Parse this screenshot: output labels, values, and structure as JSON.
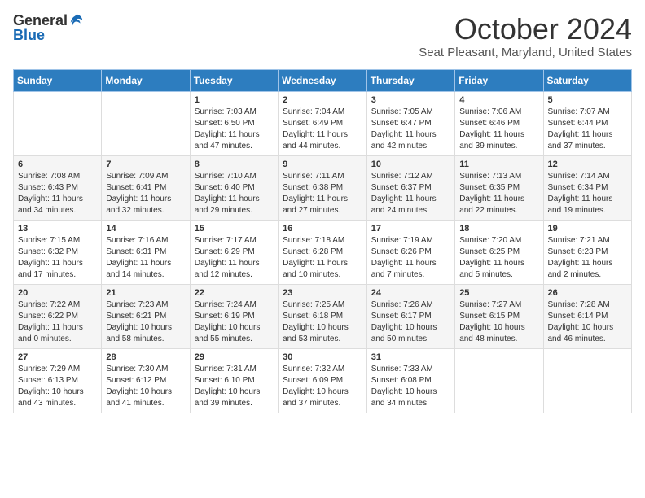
{
  "header": {
    "logo_general": "General",
    "logo_blue": "Blue",
    "month_title": "October 2024",
    "location": "Seat Pleasant, Maryland, United States"
  },
  "weekdays": [
    "Sunday",
    "Monday",
    "Tuesday",
    "Wednesday",
    "Thursday",
    "Friday",
    "Saturday"
  ],
  "weeks": [
    [
      {
        "day": "",
        "sunrise": "",
        "sunset": "",
        "daylight": ""
      },
      {
        "day": "",
        "sunrise": "",
        "sunset": "",
        "daylight": ""
      },
      {
        "day": "1",
        "sunrise": "Sunrise: 7:03 AM",
        "sunset": "Sunset: 6:50 PM",
        "daylight": "Daylight: 11 hours and 47 minutes."
      },
      {
        "day": "2",
        "sunrise": "Sunrise: 7:04 AM",
        "sunset": "Sunset: 6:49 PM",
        "daylight": "Daylight: 11 hours and 44 minutes."
      },
      {
        "day": "3",
        "sunrise": "Sunrise: 7:05 AM",
        "sunset": "Sunset: 6:47 PM",
        "daylight": "Daylight: 11 hours and 42 minutes."
      },
      {
        "day": "4",
        "sunrise": "Sunrise: 7:06 AM",
        "sunset": "Sunset: 6:46 PM",
        "daylight": "Daylight: 11 hours and 39 minutes."
      },
      {
        "day": "5",
        "sunrise": "Sunrise: 7:07 AM",
        "sunset": "Sunset: 6:44 PM",
        "daylight": "Daylight: 11 hours and 37 minutes."
      }
    ],
    [
      {
        "day": "6",
        "sunrise": "Sunrise: 7:08 AM",
        "sunset": "Sunset: 6:43 PM",
        "daylight": "Daylight: 11 hours and 34 minutes."
      },
      {
        "day": "7",
        "sunrise": "Sunrise: 7:09 AM",
        "sunset": "Sunset: 6:41 PM",
        "daylight": "Daylight: 11 hours and 32 minutes."
      },
      {
        "day": "8",
        "sunrise": "Sunrise: 7:10 AM",
        "sunset": "Sunset: 6:40 PM",
        "daylight": "Daylight: 11 hours and 29 minutes."
      },
      {
        "day": "9",
        "sunrise": "Sunrise: 7:11 AM",
        "sunset": "Sunset: 6:38 PM",
        "daylight": "Daylight: 11 hours and 27 minutes."
      },
      {
        "day": "10",
        "sunrise": "Sunrise: 7:12 AM",
        "sunset": "Sunset: 6:37 PM",
        "daylight": "Daylight: 11 hours and 24 minutes."
      },
      {
        "day": "11",
        "sunrise": "Sunrise: 7:13 AM",
        "sunset": "Sunset: 6:35 PM",
        "daylight": "Daylight: 11 hours and 22 minutes."
      },
      {
        "day": "12",
        "sunrise": "Sunrise: 7:14 AM",
        "sunset": "Sunset: 6:34 PM",
        "daylight": "Daylight: 11 hours and 19 minutes."
      }
    ],
    [
      {
        "day": "13",
        "sunrise": "Sunrise: 7:15 AM",
        "sunset": "Sunset: 6:32 PM",
        "daylight": "Daylight: 11 hours and 17 minutes."
      },
      {
        "day": "14",
        "sunrise": "Sunrise: 7:16 AM",
        "sunset": "Sunset: 6:31 PM",
        "daylight": "Daylight: 11 hours and 14 minutes."
      },
      {
        "day": "15",
        "sunrise": "Sunrise: 7:17 AM",
        "sunset": "Sunset: 6:29 PM",
        "daylight": "Daylight: 11 hours and 12 minutes."
      },
      {
        "day": "16",
        "sunrise": "Sunrise: 7:18 AM",
        "sunset": "Sunset: 6:28 PM",
        "daylight": "Daylight: 11 hours and 10 minutes."
      },
      {
        "day": "17",
        "sunrise": "Sunrise: 7:19 AM",
        "sunset": "Sunset: 6:26 PM",
        "daylight": "Daylight: 11 hours and 7 minutes."
      },
      {
        "day": "18",
        "sunrise": "Sunrise: 7:20 AM",
        "sunset": "Sunset: 6:25 PM",
        "daylight": "Daylight: 11 hours and 5 minutes."
      },
      {
        "day": "19",
        "sunrise": "Sunrise: 7:21 AM",
        "sunset": "Sunset: 6:23 PM",
        "daylight": "Daylight: 11 hours and 2 minutes."
      }
    ],
    [
      {
        "day": "20",
        "sunrise": "Sunrise: 7:22 AM",
        "sunset": "Sunset: 6:22 PM",
        "daylight": "Daylight: 11 hours and 0 minutes."
      },
      {
        "day": "21",
        "sunrise": "Sunrise: 7:23 AM",
        "sunset": "Sunset: 6:21 PM",
        "daylight": "Daylight: 10 hours and 58 minutes."
      },
      {
        "day": "22",
        "sunrise": "Sunrise: 7:24 AM",
        "sunset": "Sunset: 6:19 PM",
        "daylight": "Daylight: 10 hours and 55 minutes."
      },
      {
        "day": "23",
        "sunrise": "Sunrise: 7:25 AM",
        "sunset": "Sunset: 6:18 PM",
        "daylight": "Daylight: 10 hours and 53 minutes."
      },
      {
        "day": "24",
        "sunrise": "Sunrise: 7:26 AM",
        "sunset": "Sunset: 6:17 PM",
        "daylight": "Daylight: 10 hours and 50 minutes."
      },
      {
        "day": "25",
        "sunrise": "Sunrise: 7:27 AM",
        "sunset": "Sunset: 6:15 PM",
        "daylight": "Daylight: 10 hours and 48 minutes."
      },
      {
        "day": "26",
        "sunrise": "Sunrise: 7:28 AM",
        "sunset": "Sunset: 6:14 PM",
        "daylight": "Daylight: 10 hours and 46 minutes."
      }
    ],
    [
      {
        "day": "27",
        "sunrise": "Sunrise: 7:29 AM",
        "sunset": "Sunset: 6:13 PM",
        "daylight": "Daylight: 10 hours and 43 minutes."
      },
      {
        "day": "28",
        "sunrise": "Sunrise: 7:30 AM",
        "sunset": "Sunset: 6:12 PM",
        "daylight": "Daylight: 10 hours and 41 minutes."
      },
      {
        "day": "29",
        "sunrise": "Sunrise: 7:31 AM",
        "sunset": "Sunset: 6:10 PM",
        "daylight": "Daylight: 10 hours and 39 minutes."
      },
      {
        "day": "30",
        "sunrise": "Sunrise: 7:32 AM",
        "sunset": "Sunset: 6:09 PM",
        "daylight": "Daylight: 10 hours and 37 minutes."
      },
      {
        "day": "31",
        "sunrise": "Sunrise: 7:33 AM",
        "sunset": "Sunset: 6:08 PM",
        "daylight": "Daylight: 10 hours and 34 minutes."
      },
      {
        "day": "",
        "sunrise": "",
        "sunset": "",
        "daylight": ""
      },
      {
        "day": "",
        "sunrise": "",
        "sunset": "",
        "daylight": ""
      }
    ]
  ]
}
